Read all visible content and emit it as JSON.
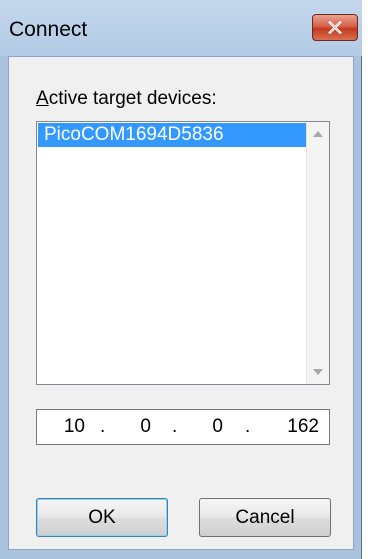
{
  "window": {
    "title": "Connect"
  },
  "devices": {
    "label_mnemonic": "A",
    "label_rest": "ctive target devices:",
    "items": [
      "PicoCOM1694D5836"
    ],
    "selected_index": 0
  },
  "ip_address": {
    "octets": [
      "10",
      "0",
      "0",
      "162"
    ],
    "separator": "."
  },
  "buttons": {
    "ok_label": "OK",
    "cancel_label": "Cancel"
  },
  "icons": {
    "close": "close-icon",
    "scroll_up": "scroll-up-arrow-icon",
    "scroll_down": "scroll-down-arrow-icon"
  },
  "colors": {
    "frame": "#a9c2dd",
    "close_button": "#c43a1f",
    "selection": "#3399ff",
    "client_background": "#f0f0f0"
  }
}
